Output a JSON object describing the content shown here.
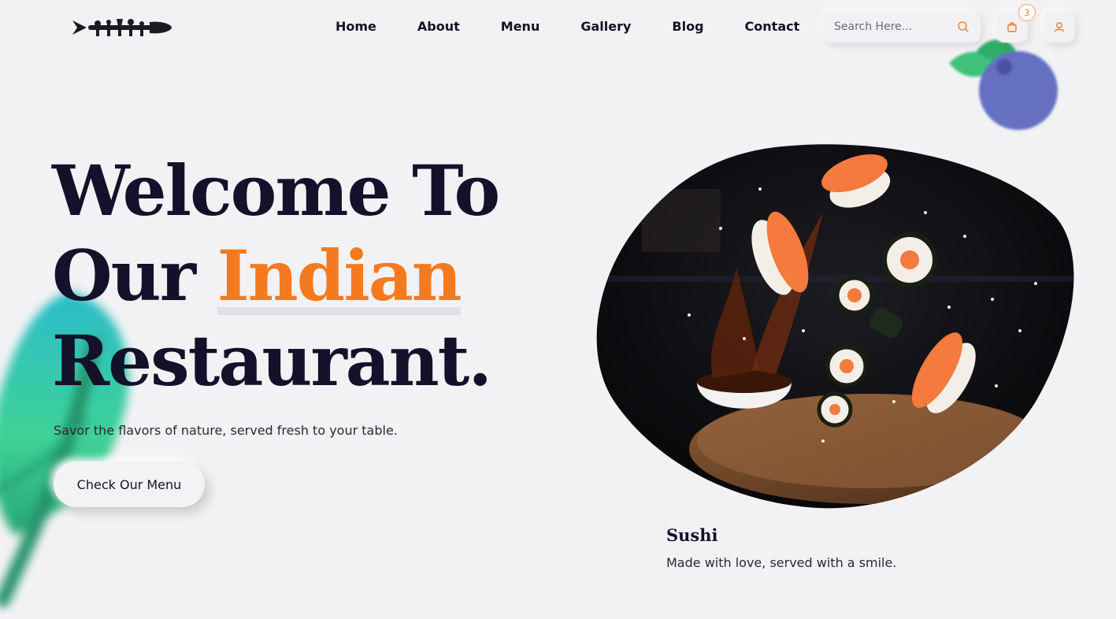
{
  "header": {
    "logo_alt": "restaurant logo",
    "nav": [
      {
        "label": "Home"
      },
      {
        "label": "About"
      },
      {
        "label": "Menu"
      },
      {
        "label": "Gallery"
      },
      {
        "label": "Blog"
      },
      {
        "label": "Contact"
      }
    ],
    "search": {
      "placeholder": "Search Here..."
    },
    "cart": {
      "count": "3"
    },
    "icons": {
      "search": "search-icon",
      "cart": "shopping-bag-icon",
      "user": "user-icon"
    }
  },
  "hero": {
    "title_line1": "Welcome To",
    "title_line2_prefix": "Our ",
    "title_accent": "Indian",
    "title_line3": "Restaurant.",
    "tagline": "Savor the flavors of nature, served fresh to your table.",
    "cta_label": "Check Our Menu"
  },
  "featured": {
    "title": "Sushi",
    "subtitle": "Made with love, served with a smile."
  },
  "colors": {
    "background": "#f2f2f5",
    "text": "#14112b",
    "accent": "#f47a1f"
  }
}
